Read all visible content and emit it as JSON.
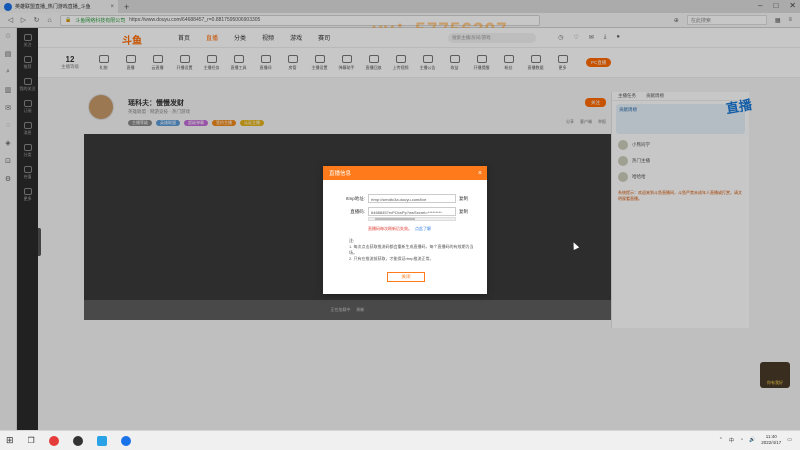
{
  "browser": {
    "tab_title": "英雄联盟直播_热门游戏直播_斗鱼",
    "tab_close": "×",
    "newtab": "+",
    "site_name": "斗鱼网络科技有限公司",
    "url": "https://www.douyu.com/64688457_r=0.8817595006903305",
    "search_placeholder": "在此搜索",
    "watermark": "yy：57756307"
  },
  "site": {
    "logo": "斗鱼",
    "nav": [
      "首页",
      "直播",
      "分类",
      "视频",
      "游戏",
      "赛司"
    ],
    "search_placeholder": "搜索主播/房间/游戏"
  },
  "left_rail": [
    "关注",
    "推荐",
    "我的关注",
    "订阅",
    "消息",
    "分类",
    "充值",
    "更多"
  ],
  "toolbar": {
    "level_num": "12",
    "level_label": "主播等级",
    "tools": [
      "礼物",
      "直播",
      "云直播",
      "开播设置",
      "主播任务",
      "直播工具",
      "直播间",
      "房管",
      "主播设置",
      "弹幕助手",
      "直播回放",
      "上传视频",
      "主播公告",
      "收益",
      "开播提醒",
      "粉丝",
      "直播数据",
      "更多"
    ],
    "pc_button": "PC直播"
  },
  "streamer": {
    "name": "瑶科夫：慢慢发财",
    "meta": "英雄联盟 · 网游竞技 · 热门游戏",
    "badges": [
      "主播等级",
      "英雄联盟",
      "超级弹幕",
      "签约主播",
      "认证主播"
    ],
    "follow": "关注",
    "share_row": [
      "分享",
      "客户端",
      "举报"
    ]
  },
  "video_foot": [
    "正在加载中",
    "刷新"
  ],
  "right_panel": {
    "tabs": [
      "主播任务",
      "贡献周榜"
    ],
    "banner": "贡献周榜",
    "users": [
      "小熊同学",
      "热门主播",
      "哈哈哈"
    ],
    "notice": "系统提示：欢迎来到斗鱼直播间，斗鱼严禁未成年人直播或打赏，请文明观看直播。"
  },
  "modal": {
    "title": "直播信息",
    "close": "×",
    "rtmp_label": "rtmp地址:",
    "rtmp_value": "rtmp://sendtc3a.douyu.com/live",
    "code_label": "直播码:",
    "code_value": "64688457rvPOcsPp?wsSecret=*********",
    "copy": "复制",
    "warn": "直播码每次刷新后失效。",
    "warn_link": "点此了解",
    "notes_title": "注:",
    "notes": [
      "1. 每次点击获取推流码都会重新生成直播码，每个直播码的有效期为当场。",
      "2. 只有在推流前获取，才能保证rtmp推流正常。"
    ],
    "button": "关闭"
  },
  "deco": {
    "bottom": "你有我好"
  },
  "taskbar": {
    "tray_text": "中",
    "time": "11:40",
    "date": "2022/4/17"
  }
}
